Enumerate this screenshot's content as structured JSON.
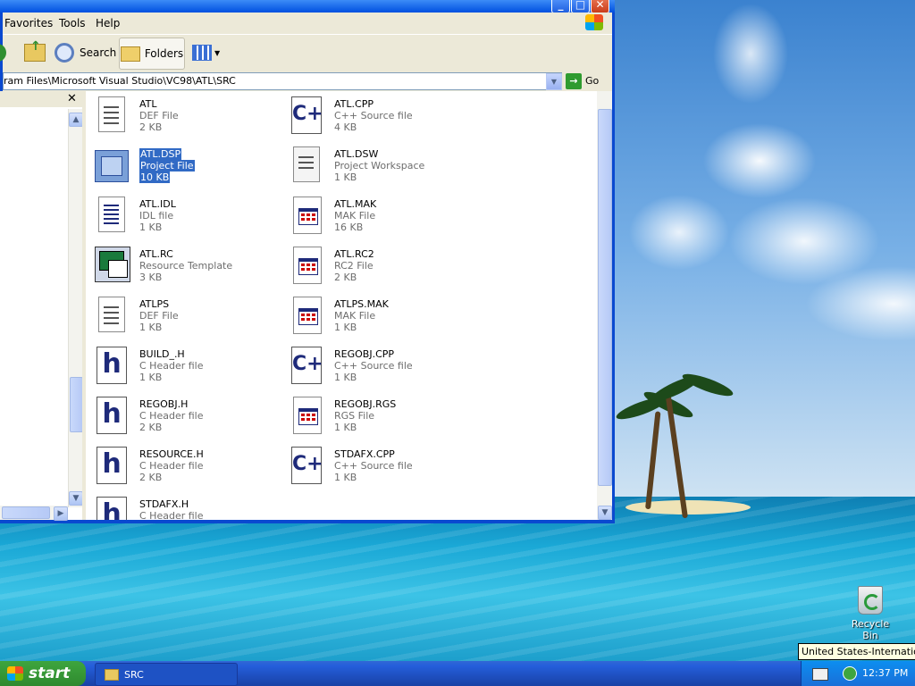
{
  "window": {
    "menu": [
      "Favorites",
      "Tools",
      "Help"
    ],
    "toolbar": {
      "search_label": "Search",
      "folders_label": "Folders"
    },
    "address": {
      "path": "ram Files\\Microsoft Visual Studio\\VC98\\ATL\\SRC",
      "go_label": "Go"
    },
    "files": [
      {
        "name": "ATL",
        "type": "DEF File",
        "size": "2 KB",
        "icon": "def-file-icon"
      },
      {
        "name": "ATL.CPP",
        "type": "C++ Source file",
        "size": "4 KB",
        "icon": "cpp-file-icon"
      },
      {
        "name": "ATL.DSP",
        "type": "Project File",
        "size": "10 KB",
        "icon": "project-file-icon",
        "selected": true
      },
      {
        "name": "ATL.DSW",
        "type": "Project Workspace",
        "size": "1 KB",
        "icon": "workspace-file-icon"
      },
      {
        "name": "ATL.IDL",
        "type": "IDL file",
        "size": "1 KB",
        "icon": "idl-file-icon"
      },
      {
        "name": "ATL.MAK",
        "type": "MAK File",
        "size": "16 KB",
        "icon": "mak-file-icon"
      },
      {
        "name": "ATL.RC",
        "type": "Resource Template",
        "size": "3 KB",
        "icon": "resource-file-icon"
      },
      {
        "name": "ATL.RC2",
        "type": "RC2 File",
        "size": "2 KB",
        "icon": "rc2-file-icon"
      },
      {
        "name": "ATLPS",
        "type": "DEF File",
        "size": "1 KB",
        "icon": "def-file-icon"
      },
      {
        "name": "ATLPS.MAK",
        "type": "MAK File",
        "size": "1 KB",
        "icon": "mak-file-icon"
      },
      {
        "name": "BUILD_.H",
        "type": "C Header file",
        "size": "1 KB",
        "icon": "header-file-icon"
      },
      {
        "name": "REGOBJ.CPP",
        "type": "C++ Source file",
        "size": "1 KB",
        "icon": "cpp-file-icon"
      },
      {
        "name": "REGOBJ.H",
        "type": "C Header file",
        "size": "2 KB",
        "icon": "header-file-icon"
      },
      {
        "name": "REGOBJ.RGS",
        "type": "RGS File",
        "size": "1 KB",
        "icon": "rgs-file-icon"
      },
      {
        "name": "RESOURCE.H",
        "type": "C Header file",
        "size": "2 KB",
        "icon": "header-file-icon"
      },
      {
        "name": "STDAFX.CPP",
        "type": "C++ Source file",
        "size": "1 KB",
        "icon": "cpp-file-icon"
      },
      {
        "name": "STDAFX.H",
        "type": "C Header file",
        "size": "",
        "icon": "header-file-icon"
      }
    ]
  },
  "desktop": {
    "recycle_bin": "Recycle Bin"
  },
  "taskbar": {
    "start_label": "start",
    "task_label": "SRC",
    "clock": "12:37 PM",
    "tooltip": "United States-International"
  }
}
